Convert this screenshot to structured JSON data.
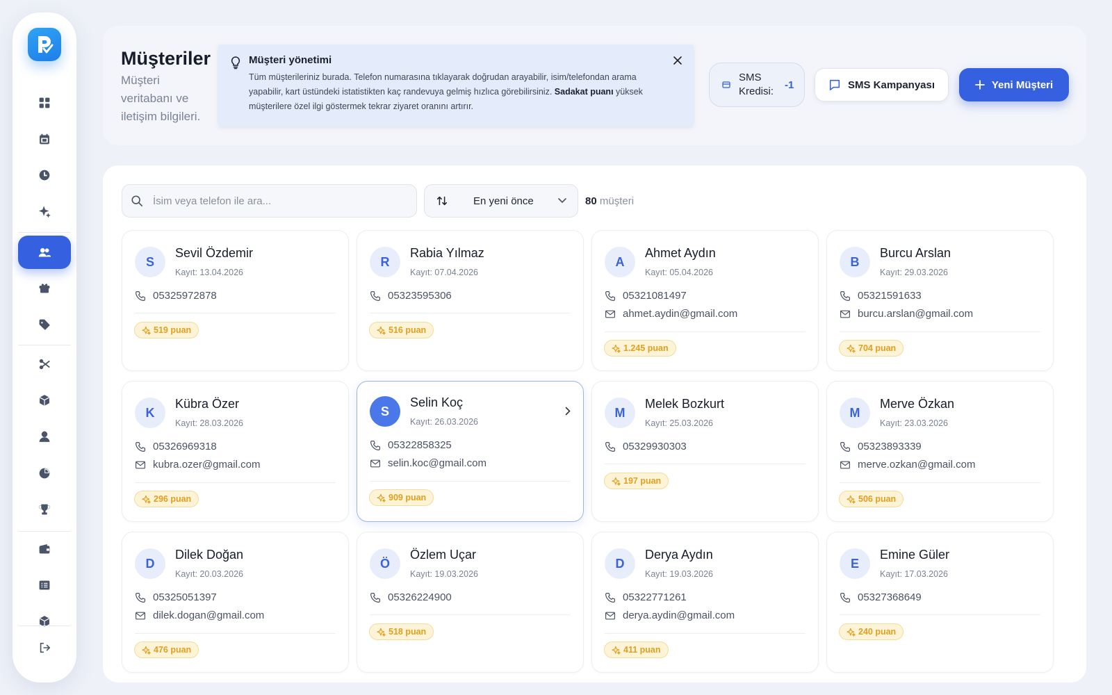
{
  "sidebar": {
    "items": [
      {
        "name": "dashboard",
        "icon": "grid-icon"
      },
      {
        "name": "calendar",
        "icon": "calendar-icon"
      },
      {
        "name": "history",
        "icon": "clock-icon"
      },
      {
        "name": "ai",
        "icon": "sparkle-icon"
      },
      {
        "name": "customers",
        "icon": "users-icon",
        "active": true
      },
      {
        "name": "gifts",
        "icon": "gift-icon"
      },
      {
        "name": "tags",
        "icon": "tag-icon"
      },
      {
        "name": "services",
        "icon": "scissors-icon"
      },
      {
        "name": "products",
        "icon": "box-icon"
      },
      {
        "name": "staff",
        "icon": "user-icon"
      },
      {
        "name": "reports",
        "icon": "pie-chart-icon"
      },
      {
        "name": "rewards",
        "icon": "trophy-icon"
      },
      {
        "name": "wallet",
        "icon": "wallet-icon"
      },
      {
        "name": "cash",
        "icon": "receipt-icon"
      },
      {
        "name": "inventory",
        "icon": "package-icon"
      }
    ],
    "logout_icon": "logout-icon"
  },
  "header": {
    "title": "Müşteriler",
    "subtitle": "Müşteri veritabanı ve iletişim bilgileri.",
    "info": {
      "title": "Müşteri yönetimi",
      "text_before": "Tüm müşterileriniz burada. Telefon numarasına tıklayarak doğrudan arayabilir, isim/telefondan arama yapabilir, kart üstündeki istatistikten kaç randevuya gelmiş hızlıca görebilirsiniz. ",
      "text_bold": "Sadakat puanı",
      "text_after": " yüksek müşterilere özel ilgi göstermek tekrar ziyaret oranını artırır."
    },
    "sms_credit_label": "SMS Kredisi:",
    "sms_credit_value": "-1",
    "sms_campaign_label": "SMS Kampanyası",
    "new_customer_label": "Yeni Müşteri"
  },
  "toolbar": {
    "search_placeholder": "İsim veya telefon ile ara...",
    "sort_label": "En yeni önce",
    "count_number": "80",
    "count_label": "müşteri"
  },
  "customers": [
    {
      "initial": "S",
      "name": "Sevil Özdemir",
      "date": "Kayıt: 13.04.2026",
      "phone": "05325972878",
      "email": "",
      "points": "519 puan"
    },
    {
      "initial": "R",
      "name": "Rabia Yılmaz",
      "date": "Kayıt: 07.04.2026",
      "phone": "05323595306",
      "email": "",
      "points": "516 puan"
    },
    {
      "initial": "A",
      "name": "Ahmet Aydın",
      "date": "Kayıt: 05.04.2026",
      "phone": "05321081497",
      "email": "ahmet.aydin@gmail.com",
      "points": "1.245 puan"
    },
    {
      "initial": "B",
      "name": "Burcu Arslan",
      "date": "Kayıt: 29.03.2026",
      "phone": "05321591633",
      "email": "burcu.arslan@gmail.com",
      "points": "704 puan"
    },
    {
      "initial": "K",
      "name": "Kübra Özer",
      "date": "Kayıt: 28.03.2026",
      "phone": "05326969318",
      "email": "kubra.ozer@gmail.com",
      "points": "296 puan"
    },
    {
      "initial": "S",
      "name": "Selin Koç",
      "date": "Kayıt: 26.03.2026",
      "phone": "05322858325",
      "email": "selin.koc@gmail.com",
      "points": "909 puan",
      "hover": true
    },
    {
      "initial": "M",
      "name": "Melek Bozkurt",
      "date": "Kayıt: 25.03.2026",
      "phone": "05329930303",
      "email": "",
      "points": "197 puan"
    },
    {
      "initial": "M",
      "name": "Merve Özkan",
      "date": "Kayıt: 23.03.2026",
      "phone": "05323893339",
      "email": "merve.ozkan@gmail.com",
      "points": "506 puan"
    },
    {
      "initial": "D",
      "name": "Dilek Doğan",
      "date": "Kayıt: 20.03.2026",
      "phone": "05325051397",
      "email": "dilek.dogan@gmail.com",
      "points": "476 puan"
    },
    {
      "initial": "Ö",
      "name": "Özlem Uçar",
      "date": "Kayıt: 19.03.2026",
      "phone": "05326224900",
      "email": "",
      "points": "518 puan"
    },
    {
      "initial": "D",
      "name": "Derya Aydın",
      "date": "Kayıt: 19.03.2026",
      "phone": "05322771261",
      "email": "derya.aydin@gmail.com",
      "points": "411 puan"
    },
    {
      "initial": "E",
      "name": "Emine Güler",
      "date": "Kayıt: 17.03.2026",
      "phone": "05327368649",
      "email": "",
      "points": "240 puan"
    }
  ],
  "colors": {
    "accent": "#3560e0",
    "points_bg": "#fdf3d6",
    "points_text": "#e0a020"
  }
}
